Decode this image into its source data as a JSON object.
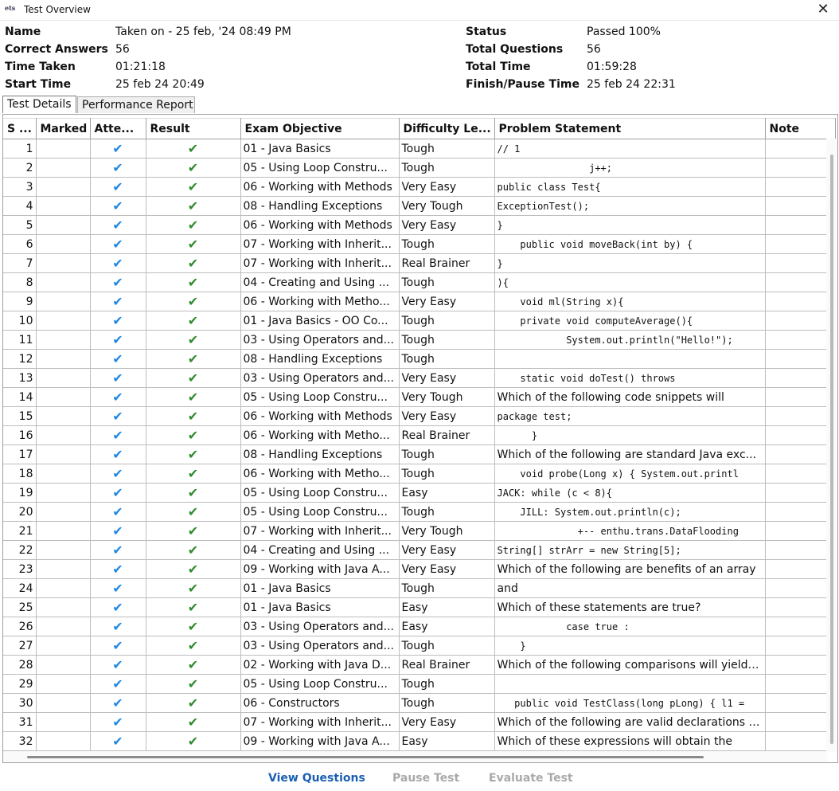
{
  "window": {
    "icon_text": "ets",
    "title": "Test Overview",
    "close_icon": "close-icon"
  },
  "info": {
    "name_label": "Name",
    "name_value": "Taken on - 25 feb, '24 08:49 PM",
    "correct_label": "Correct Answers",
    "correct_value": "56",
    "time_taken_label": "Time Taken",
    "time_taken_value": "01:21:18",
    "start_label": "Start Time",
    "start_value": "25 feb 24 20:49",
    "status_label": "Status",
    "status_value": "Passed 100%",
    "total_q_label": "Total Questions",
    "total_q_value": "56",
    "total_time_label": "Total Time",
    "total_time_value": "01:59:28",
    "finish_label": "Finish/Pause Time",
    "finish_value": "25 feb 24 22:31"
  },
  "tabs": [
    {
      "label": "Test Details",
      "active": true
    },
    {
      "label": "Performance Report",
      "active": false
    }
  ],
  "columns": [
    "S ...",
    "Marked",
    "Atte...",
    "Result",
    "Exam Objective",
    "Difficulty Le...",
    "Problem Statement",
    "Note"
  ],
  "rows": [
    {
      "sn": "1",
      "objective": "01 - Java Basics",
      "difficulty": "Tough",
      "problem": "// 1",
      "code": true
    },
    {
      "sn": "2",
      "objective": "05 - Using Loop Constru...",
      "difficulty": "Tough",
      "problem": "                j++;",
      "code": true
    },
    {
      "sn": "3",
      "objective": "06 - Working with Methods",
      "difficulty": "Very Easy",
      "problem": "public class Test{",
      "code": true
    },
    {
      "sn": "4",
      "objective": "08 - Handling Exceptions",
      "difficulty": "Very Tough",
      "problem": "ExceptionTest();",
      "code": true
    },
    {
      "sn": "5",
      "objective": "06 - Working with Methods",
      "difficulty": "Very Easy",
      "problem": "}",
      "code": true
    },
    {
      "sn": "6",
      "objective": "07 - Working with Inherit...",
      "difficulty": "Tough",
      "problem": "    public void moveBack(int by) {",
      "code": true
    },
    {
      "sn": "7",
      "objective": "07 - Working with Inherit...",
      "difficulty": "Real Brainer",
      "problem": "}",
      "code": true
    },
    {
      "sn": "8",
      "objective": "04 - Creating and Using ...",
      "difficulty": "Tough",
      "problem": "){",
      "code": true
    },
    {
      "sn": "9",
      "objective": "06 - Working with Metho...",
      "difficulty": "Very Easy",
      "problem": "    void ml(String x){",
      "code": true
    },
    {
      "sn": "10",
      "objective": "01 - Java Basics - OO Co...",
      "difficulty": "Tough",
      "problem": "    private void computeAverage(){",
      "code": true
    },
    {
      "sn": "11",
      "objective": "03 - Using Operators and...",
      "difficulty": "Tough",
      "problem": "            System.out.println(\"Hello!\");",
      "code": true
    },
    {
      "sn": "12",
      "objective": "08 - Handling Exceptions",
      "difficulty": "Tough",
      "problem": "",
      "code": true
    },
    {
      "sn": "13",
      "objective": "03 - Using Operators and...",
      "difficulty": "Very Easy",
      "problem": "    static void doTest() throws",
      "code": true
    },
    {
      "sn": "14",
      "objective": "05 - Using Loop Constru...",
      "difficulty": "Very Tough",
      "problem": "Which of the following code snippets will",
      "code": false
    },
    {
      "sn": "15",
      "objective": "06 - Working with Methods",
      "difficulty": "Very Easy",
      "problem": "package test;",
      "code": true
    },
    {
      "sn": "16",
      "objective": "06 - Working with Metho...",
      "difficulty": "Real Brainer",
      "problem": "      }",
      "code": true
    },
    {
      "sn": "17",
      "objective": "08 - Handling Exceptions",
      "difficulty": "Tough",
      "problem": "Which of the following are standard Java exc...",
      "code": false
    },
    {
      "sn": "18",
      "objective": "06 - Working with Metho...",
      "difficulty": "Tough",
      "problem": "    void probe(Long x) { System.out.printl",
      "code": true
    },
    {
      "sn": "19",
      "objective": "05 - Using Loop Constru...",
      "difficulty": "Easy",
      "problem": "JACK: while (c < 8){",
      "code": true
    },
    {
      "sn": "20",
      "objective": "05 - Using Loop Constru...",
      "difficulty": "Tough",
      "problem": "    JILL: System.out.println(c);",
      "code": true
    },
    {
      "sn": "21",
      "objective": "07 - Working with Inherit...",
      "difficulty": "Very Tough",
      "problem": "              +-- enthu.trans.DataFlooding",
      "code": true
    },
    {
      "sn": "22",
      "objective": "04 - Creating and Using ...",
      "difficulty": "Very Easy",
      "problem": "String[] strArr = new String[5];",
      "code": true
    },
    {
      "sn": "23",
      "objective": "09 - Working with Java A...",
      "difficulty": "Very Easy",
      "problem": "Which of the following are benefits of an array",
      "code": false
    },
    {
      "sn": "24",
      "objective": "01 - Java Basics",
      "difficulty": "Tough",
      "problem": "and",
      "code": false
    },
    {
      "sn": "25",
      "objective": "01 - Java Basics",
      "difficulty": "Easy",
      "problem": "Which of these statements are true?",
      "code": false
    },
    {
      "sn": "26",
      "objective": "03 - Using Operators and...",
      "difficulty": "Easy",
      "problem": "            case true :",
      "code": true
    },
    {
      "sn": "27",
      "objective": "03 - Using Operators and...",
      "difficulty": "Tough",
      "problem": "    }",
      "code": true
    },
    {
      "sn": "28",
      "objective": "02 - Working with Java D...",
      "difficulty": "Real Brainer",
      "problem": "Which of the following comparisons will yield f...",
      "code": false
    },
    {
      "sn": "29",
      "objective": "05 - Using Loop Constru...",
      "difficulty": "Tough",
      "problem": "",
      "code": false
    },
    {
      "sn": "30",
      "objective": "06 - Constructors",
      "difficulty": "Tough",
      "problem": "   public void TestClass(long pLong) { l1 =",
      "code": true
    },
    {
      "sn": "31",
      "objective": "07 - Working with Inherit...",
      "difficulty": "Very Easy",
      "problem": "Which of the following are valid declarations i...",
      "code": false
    },
    {
      "sn": "32",
      "objective": "09 - Working with Java A...",
      "difficulty": "Easy",
      "problem": "Which of these expressions will obtain the",
      "code": false
    }
  ],
  "attempted_icon": "checkmark-icon",
  "result_icon": "checkmark-icon",
  "buttons": {
    "view": "View Questions",
    "pause": "Pause Test",
    "evaluate": "Evaluate Test"
  },
  "colors": {
    "attempted_check": "#1e88e5",
    "result_check": "#2e8b2e",
    "primary_button": "#1a5fb4",
    "disabled_button": "#a9a9a9"
  }
}
